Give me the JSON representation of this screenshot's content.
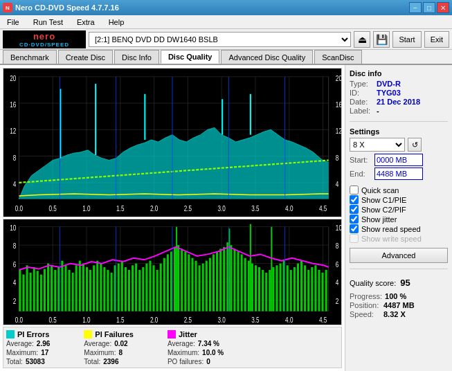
{
  "title_bar": {
    "title": "Nero CD-DVD Speed 4.7.7.16",
    "icon": "N",
    "min_label": "−",
    "max_label": "□",
    "close_label": "✕"
  },
  "menu": {
    "items": [
      "File",
      "Run Test",
      "Extra",
      "Help"
    ]
  },
  "toolbar": {
    "drive_label": "[2:1]  BENQ DVD DD DW1640 BSLB",
    "start_label": "Start",
    "exit_label": "Exit"
  },
  "tabs": [
    {
      "label": "Benchmark",
      "active": false
    },
    {
      "label": "Create Disc",
      "active": false
    },
    {
      "label": "Disc Info",
      "active": false
    },
    {
      "label": "Disc Quality",
      "active": true
    },
    {
      "label": "Advanced Disc Quality",
      "active": false
    },
    {
      "label": "ScanDisc",
      "active": false
    }
  ],
  "chart_top": {
    "y_labels_right": [
      "20",
      "16",
      "12",
      "8",
      "4",
      "0"
    ],
    "y_labels_left": [
      "20",
      "16",
      "12",
      "8",
      "4",
      "0"
    ],
    "x_labels": [
      "0.0",
      "0.5",
      "1.0",
      "1.5",
      "2.0",
      "2.5",
      "3.0",
      "3.5",
      "4.0",
      "4.5"
    ]
  },
  "chart_bottom": {
    "y_labels_right": [
      "10",
      "8",
      "6",
      "4",
      "2",
      "0"
    ],
    "y_labels_left": [
      "10",
      "8",
      "6",
      "4",
      "2",
      "0"
    ],
    "x_labels": [
      "0.0",
      "0.5",
      "1.0",
      "1.5",
      "2.0",
      "2.5",
      "3.0",
      "3.5",
      "4.0",
      "4.5"
    ]
  },
  "legend": {
    "pi_errors": {
      "title": "PI Errors",
      "color": "#00ffff",
      "average_label": "Average:",
      "average_value": "2.96",
      "maximum_label": "Maximum:",
      "maximum_value": "17",
      "total_label": "Total:",
      "total_value": "53083"
    },
    "pi_failures": {
      "title": "PI Failures",
      "color": "#ffff00",
      "average_label": "Average:",
      "average_value": "0.02",
      "maximum_label": "Maximum:",
      "maximum_value": "8",
      "total_label": "Total:",
      "total_value": "2396"
    },
    "jitter": {
      "title": "Jitter",
      "color": "#ff00ff",
      "average_label": "Average:",
      "average_value": "7.34 %",
      "maximum_label": "Maximum:",
      "maximum_value": "10.0 %",
      "po_failures_label": "PO failures:",
      "po_failures_value": "0"
    }
  },
  "disc_info": {
    "title": "Disc info",
    "type_label": "Type:",
    "type_value": "DVD-R",
    "id_label": "ID:",
    "id_value": "TYG03",
    "date_label": "Date:",
    "date_value": "21 Dec 2018",
    "label_label": "Label:",
    "label_value": "-"
  },
  "settings": {
    "title": "Settings",
    "speed_label": "8 X",
    "start_label": "Start:",
    "start_value": "0000 MB",
    "end_label": "End:",
    "end_value": "4488 MB",
    "quick_scan_label": "Quick scan",
    "show_c1_pie_label": "Show C1/PIE",
    "show_c2_pif_label": "Show C2/PIF",
    "show_jitter_label": "Show jitter",
    "show_read_speed_label": "Show read speed",
    "show_write_speed_label": "Show write speed",
    "advanced_label": "Advanced"
  },
  "quality": {
    "score_label": "Quality score:",
    "score_value": "95",
    "progress_label": "Progress:",
    "progress_value": "100 %",
    "position_label": "Position:",
    "position_value": "4487 MB",
    "speed_label": "Speed:",
    "speed_value": "8.32 X"
  }
}
